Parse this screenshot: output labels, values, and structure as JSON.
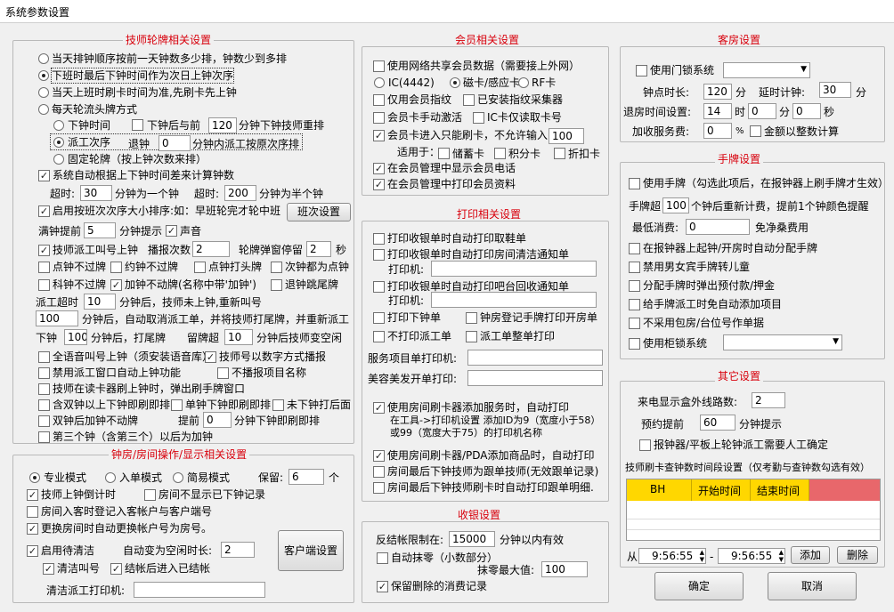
{
  "window": {
    "title": "系统参数设置"
  },
  "g1": {
    "title": "技师轮牌相关设置",
    "r1": "当天排钟顺序按前一天钟数多少排，钟数少到多排",
    "r2": "下班时最后下钟时间作为次日上钟次序",
    "r3": "当天上班时刷卡时间为准,先刷卡先上钟",
    "r4": "每天轮流头牌方式",
    "r4a": "下钟时间",
    "c_after": "下钟后与前",
    "after_v": "120",
    "after_s": "分钟下钟技师重排",
    "r4b": "派工次序",
    "tuizhong": "退钟",
    "tui_v": "0",
    "tui_s": "分钟内派工按原次序排",
    "r4c": "固定轮牌（按上钟次数来排）",
    "auto_calc": "系统自动根据上下钟时间差来计算钟数",
    "overtime": "超时:",
    "ot_v1": "30",
    "ot_s1": "分钟为一个钟",
    "overtime2": "超时:",
    "ot_v2": "200",
    "ot_s2": "分钟为半个钟",
    "shift_sort": "启用按班次次序大小排序:如：早班轮完才轮中班",
    "shift_btn": "班次设置",
    "full_remind": "满钟提前",
    "full_v": "5",
    "full_s": "分钟提示",
    "sound": "声音",
    "call": "技师派工叫号上钟",
    "play_times": "播报次数",
    "play_v": "2",
    "stop": "轮牌弹窗停留",
    "stop_v": "2",
    "sec": "秒",
    "p1": "点钟不过牌",
    "p2": "约钟不过牌",
    "p3": "点钟打头牌",
    "p4": "次钟都为点钟",
    "p5": "科钟不过牌",
    "p6": "加钟不动牌(名称中带'加钟')",
    "p7": "退钟跳尾牌",
    "dispatch_ot": "派工超时",
    "dot_v": "10",
    "dot_s": "分钟后，技师未上钟,重新叫号",
    "cancel_v": "100",
    "cancel_s": "分钟后，自动取消派工单，并将技师打尾牌，并重新派工",
    "clock": "下钟",
    "clock_v": "100",
    "clock_s": "分钟后，打尾牌",
    "stay": "留牌超",
    "stay_v": "10",
    "stay_s": "分钟后技师变空闲",
    "voice": "全语音叫号上钟（须安装语音库）",
    "num": "技师号以数字方式播报",
    "forbid": "禁用派工窗口自动上钟功能",
    "noplay": "不播报项目名称",
    "reader": "技师在读卡器刷上钟时，弹出刷手牌窗口",
    "sec_clock": "含双钟以上下钟即刷即排",
    "sec2": "单钟下钟即刷即排",
    "sec3": "未下钟打后面",
    "double": "双钟后加钟不动牌",
    "ahead": "提前",
    "ahead_v": "0",
    "ahead_s": "分钟下钟即刷即排",
    "third": "第三个钟（含第三个）以后为加钟"
  },
  "g2": {
    "title": "钟房/房间操作/显示相关设置",
    "pro": "专业模式",
    "entry": "入单模式",
    "simple": "简易模式",
    "keep": "保留:",
    "keep_v": "6",
    "ge": "个",
    "timer": "技师上钟倒计时",
    "room_hide": "房间不显示已下钟记录",
    "reg": "房间入客时登记入客帐户与客户端号",
    "change": "更换房间时自动更换帐户号为房号。",
    "clean": "启用待清洁",
    "auto_free": "自动变为空闲时长:",
    "auto_v": "2",
    "client_btn": "客户端设置",
    "clean_call": "清洁叫号",
    "after_close": "结帐后进入已结帐",
    "printer": "清洁派工打印机:",
    "printer_v": ""
  },
  "g3": {
    "title": "会员相关设置",
    "shared": "使用网络共享会员数据（需要接上外网）",
    "ic": "IC(4442)",
    "mag": "磁卡/感应卡",
    "rf": "RF卡",
    "finger": "仅用会员指纹",
    "finger2": "已安装指纹采集器",
    "manual": "会员卡手动激活",
    "icread": "IC卡仅读取卡号",
    "only_card": "会员卡进入只能刷卡，不允许输入",
    "only_v": "100",
    "apply": "适用于：",
    "a1": "储蓄卡",
    "a2": "积分卡",
    "a3": "折扣卡",
    "show_phone": "在会员管理中显示会员电话",
    "print_info": "在会员管理中打印会员资料"
  },
  "g4": {
    "title": "打印相关设置",
    "pr1": "打印收银单时自动打印取鞋单",
    "pr2": "打印收银单时自动打印房间清洁通知单",
    "printer": "打印机:",
    "pr3": "打印收银单时自动打印吧台回收通知单",
    "pr4": "打印下钟单",
    "pr5": "钟房登记手牌打印开房单",
    "pr6": "不打印派工单",
    "pr7": "派工单整单打印",
    "svc": "服务项目单打印机:",
    "beauty": "美容美发开单打印:",
    "pr8": "使用房间刷卡器添加服务时，自动打印",
    "pr8b": "在工具->打印机设置 添加ID为9（宽度小于58）或99（宽度大于75）的打印机名称",
    "pr9": "使用房间刷卡器/PDA添加商品时，自动打印",
    "pr10": "房间最后下钟技师为跟单技师(无效跟单记录)",
    "pr11": "房间最后下钟技师刷卡时自动打印跟单明细."
  },
  "g5": {
    "title": "收银设置",
    "limit": "反结帐限制在:",
    "limit_v": "15000",
    "limit_s": "分钟以内有效",
    "round": "自动抹零（小数部分）",
    "round_max": "抹零最大值:",
    "round_v": "100",
    "keep_del": "保留删除的消费记录"
  },
  "g6": {
    "title": "客房设置",
    "door": "使用门锁系统",
    "door_v": "",
    "start": "钟点时长:",
    "start_v": "120",
    "min": "分",
    "delay": "延时计钟:",
    "delay_v": "30",
    "min2": "分",
    "checkout": "退房时间设置:",
    "h_v": "14",
    "hour": "时",
    "m_v": "0",
    "min3": "分",
    "s_v": "0",
    "sec": "秒",
    "fee": "加收服务费:",
    "fee_v": "0",
    "pct": "%",
    "int": "金额以整数计算"
  },
  "g7": {
    "title": "手牌设置",
    "use": "使用手牌（勾选此项后，在报钟器上刷手牌才生效）",
    "hp": "手牌超",
    "hp_v": "100",
    "hp_s": "个钟后重新计费，提前1个钟颜色提醒",
    "low": "最低消费:",
    "low_v": "0",
    "free": "免净桑费用",
    "h1": "在报钟器上起钟/开房时自动分配手牌",
    "h2": "禁用男女宾手牌转儿童",
    "h3": "分配手牌时弹出预付款/押金",
    "h4": "给手牌派工时免自动添加项目",
    "h5": "不采用包房/台位号作单据",
    "h6": "使用柜锁系统",
    "h6_v": ""
  },
  "g8": {
    "title": "其它设置",
    "caller": "来电显示盒外线路数:",
    "caller_v": "2",
    "remind": "预约提前",
    "remind_v": "60",
    "remind_s": "分钟提示",
    "confirm": "报钟器/平板上轮钟派工需要人工确定",
    "period": "技师刷卡查钟数时间段设置（仅考勤与查钟数勾选有效）",
    "cols": [
      "BH",
      "开始时间",
      "结束时间"
    ],
    "from": "从",
    "t1": "9:56:55",
    "dash": "-",
    "t2": "9:56:55",
    "add": "添加",
    "del": "删除"
  },
  "footer": {
    "ok": "确定",
    "cancel": "取消"
  }
}
